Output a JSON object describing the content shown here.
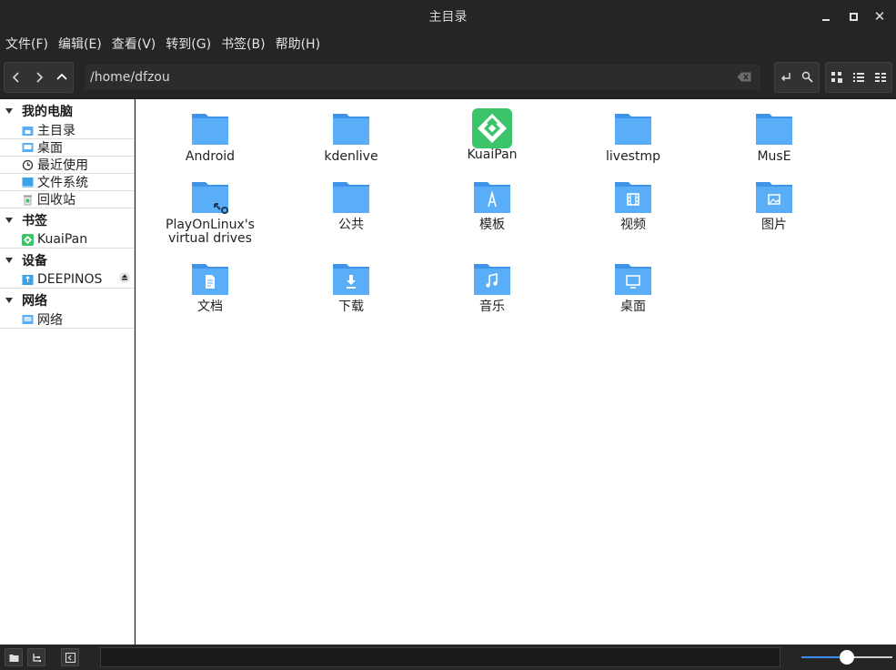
{
  "window": {
    "title": "主目录"
  },
  "menu": [
    "文件(F)",
    "编辑(E)",
    "查看(V)",
    "转到(G)",
    "书签(B)",
    "帮助(H)"
  ],
  "toolbar": {
    "path": "/home/dfzou"
  },
  "sidebar": {
    "sections": [
      {
        "label": "我的电脑",
        "items": [
          {
            "label": "主目录",
            "icon": "home-folder-icon"
          },
          {
            "label": "桌面",
            "icon": "desktop-icon"
          },
          {
            "label": "最近使用",
            "icon": "clock-icon"
          },
          {
            "label": "文件系统",
            "icon": "drive-icon"
          },
          {
            "label": "回收站",
            "icon": "trash-icon"
          }
        ]
      },
      {
        "label": "书签",
        "items": [
          {
            "label": "KuaiPan",
            "icon": "kuaipan-icon"
          }
        ]
      },
      {
        "label": "设备",
        "items": [
          {
            "label": "DEEPINOS",
            "icon": "usb-drive-icon"
          }
        ]
      },
      {
        "label": "网络",
        "items": [
          {
            "label": "网络",
            "icon": "network-icon"
          }
        ]
      }
    ]
  },
  "files": [
    {
      "label": "Android",
      "icon": "folder"
    },
    {
      "label": "kdenlive",
      "icon": "folder"
    },
    {
      "label": "KuaiPan",
      "icon": "kuaipan-app"
    },
    {
      "label": "livestmp",
      "icon": "folder"
    },
    {
      "label": "MusE",
      "icon": "folder"
    },
    {
      "label": "PlayOnLinux's virtual drives",
      "icon": "folder-link"
    },
    {
      "label": "公共",
      "icon": "folder"
    },
    {
      "label": "模板",
      "icon": "folder-templates"
    },
    {
      "label": "视频",
      "icon": "folder-videos"
    },
    {
      "label": "图片",
      "icon": "folder-pictures"
    },
    {
      "label": "文档",
      "icon": "folder-documents"
    },
    {
      "label": "下载",
      "icon": "folder-downloads"
    },
    {
      "label": "音乐",
      "icon": "folder-music"
    },
    {
      "label": "桌面",
      "icon": "folder-desktop"
    }
  ],
  "colors": {
    "folder": "#5aaef8",
    "folder_dark": "#3d94e8",
    "kuaipan": "#3cc46a",
    "accent": "#3b8cf0"
  },
  "status": {
    "zoom_level": 0.5
  }
}
